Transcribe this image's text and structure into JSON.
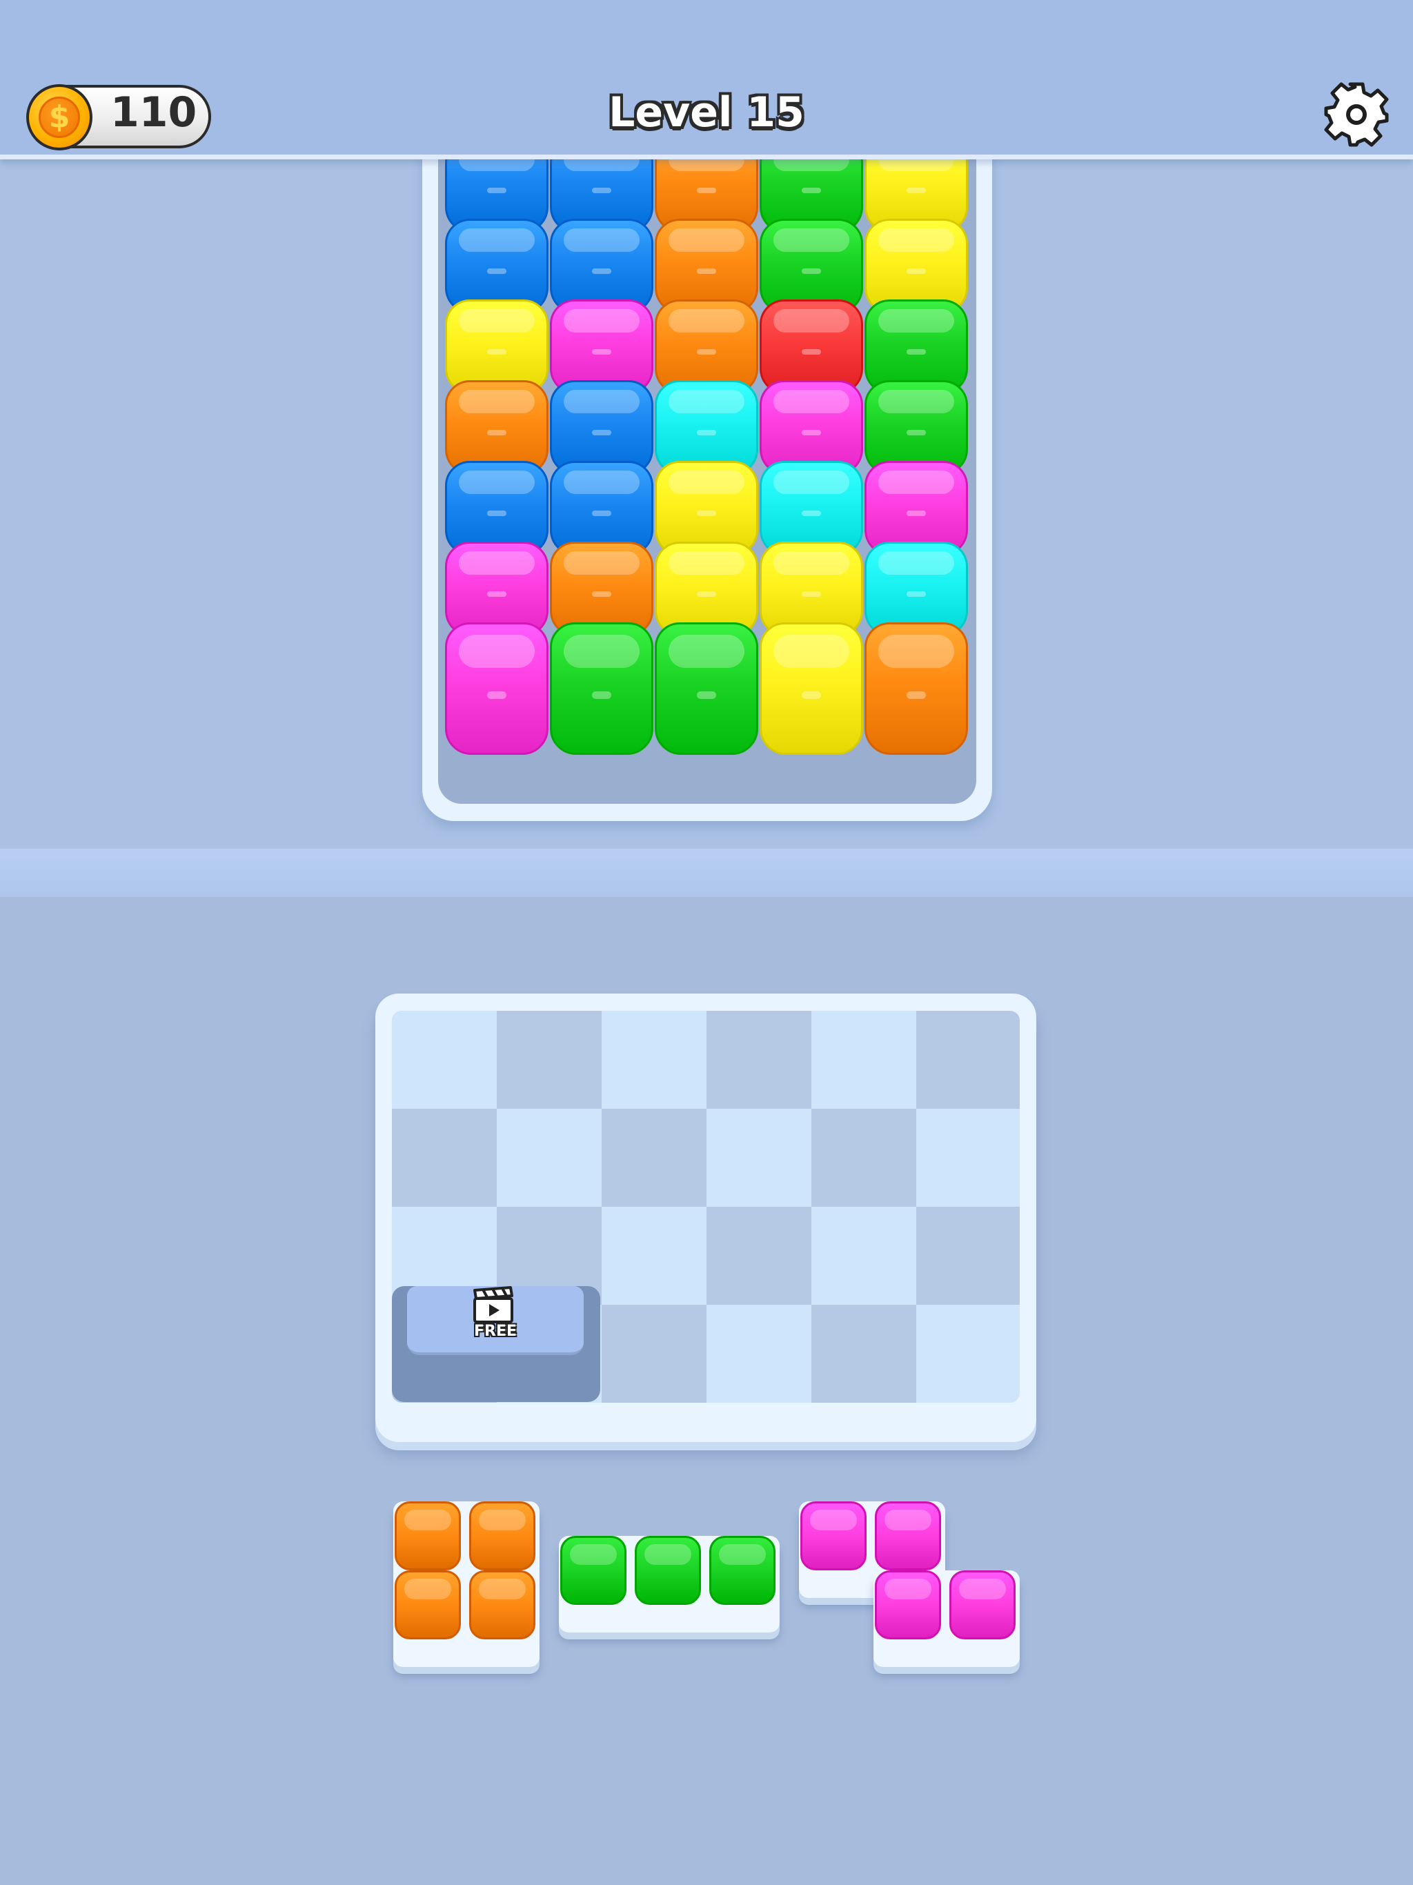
{
  "header": {
    "coins": "110",
    "coin_symbol": "$",
    "level_title": "Level 15",
    "settings_icon": "gear-icon"
  },
  "colors": {
    "blue": "#1a86f2",
    "orange": "#ff8a12",
    "green": "#1ad324",
    "yellow": "#fff21c",
    "magenta": "#ff3ee0",
    "red": "#fa3a3a",
    "cyan": "#1af2f2"
  },
  "jar": {
    "columns": 5,
    "grid": [
      [
        "blue",
        "blue",
        "orange",
        "green",
        "yellow"
      ],
      [
        "blue",
        "blue",
        "orange",
        "green",
        "yellow"
      ],
      [
        "yellow",
        "magenta",
        "orange",
        "red",
        "green"
      ],
      [
        "orange",
        "blue",
        "cyan",
        "magenta",
        "green"
      ],
      [
        "blue",
        "blue",
        "yellow",
        "cyan",
        "magenta"
      ],
      [
        "magenta",
        "orange",
        "yellow",
        "yellow",
        "cyan"
      ],
      [
        "magenta",
        "green",
        "green",
        "yellow",
        "orange"
      ]
    ]
  },
  "tray": {
    "rows": 4,
    "cols": 6,
    "free_slot": {
      "label": "FREE",
      "icon": "clapperboard-play-icon"
    }
  },
  "pieces": [
    {
      "name": "square-piece",
      "color": "orange",
      "cells": [
        [
          0,
          0
        ],
        [
          0,
          1
        ],
        [
          1,
          0
        ],
        [
          1,
          1
        ]
      ]
    },
    {
      "name": "line-piece",
      "color": "green",
      "cells": [
        [
          0,
          0
        ],
        [
          0,
          1
        ],
        [
          0,
          2
        ]
      ]
    },
    {
      "name": "z-piece",
      "color": "magenta",
      "cells": [
        [
          0,
          0
        ],
        [
          0,
          1
        ],
        [
          1,
          1
        ],
        [
          1,
          2
        ]
      ]
    }
  ]
}
